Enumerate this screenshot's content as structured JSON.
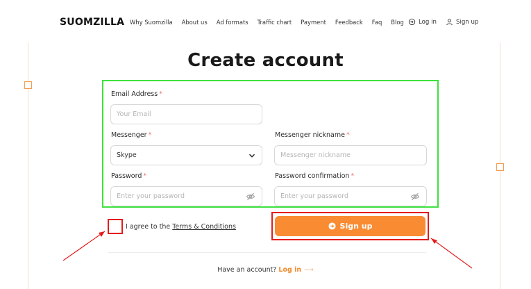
{
  "brand": {
    "logo": "SUOMZILLA"
  },
  "nav": {
    "items": [
      "Why Suomzilla",
      "About us",
      "Ad formats",
      "Traffic chart",
      "Payment",
      "Feedback",
      "Faq",
      "Blog"
    ]
  },
  "auth": {
    "login": "Log in",
    "signup": "Sign up"
  },
  "page": {
    "title": "Create account"
  },
  "form": {
    "email_label": "Email Address",
    "email_placeholder": "Your Email",
    "messenger_label": "Messenger",
    "messenger_value": "Skype",
    "nickname_label": "Messenger nickname",
    "nickname_placeholder": "Messenger nickname",
    "password_label": "Password",
    "password_placeholder": "Enter your password",
    "confirm_label": "Password confirmation",
    "confirm_placeholder": "Enter your password",
    "required_mark": "*"
  },
  "agree": {
    "text": "I agree to the",
    "terms": "Terms & Conditions"
  },
  "submit": {
    "label": "Sign up"
  },
  "footer": {
    "question": "Have an account?",
    "login": "Log in",
    "arrow": "⟶"
  },
  "colors": {
    "accent": "#f98b32",
    "annotation_green": "#3ee13e",
    "annotation_red": "#e41c1c"
  }
}
